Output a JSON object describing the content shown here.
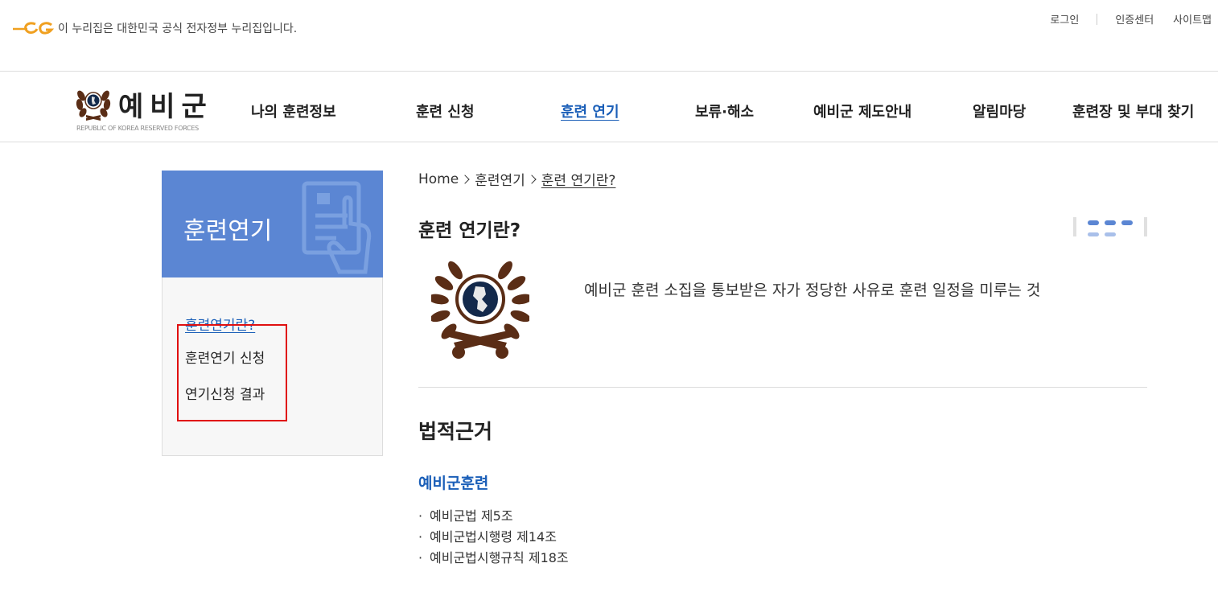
{
  "top": {
    "gov_notice": "이 누리집은 대한민국 공식 전자정부 누리집입니다.",
    "util_links": [
      "로그인",
      "인증센터",
      "사이트맵"
    ]
  },
  "brand": {
    "name": "예비군",
    "subtitle": "REPUBLIC OF KOREA RESERVED FORCES"
  },
  "nav": {
    "items": [
      "나의 훈련정보",
      "훈련 신청",
      "훈련 연기",
      "보류·해소",
      "예비군 제도안내",
      "알림마당",
      "훈련장 및 부대 찾기"
    ],
    "active_index": 2
  },
  "sidebar": {
    "title": "훈련연기",
    "items": [
      "훈련연기란?",
      "훈련연기 신청",
      "연기신청 결과"
    ],
    "active_index": 0
  },
  "breadcrumb": [
    "Home",
    "훈련연기",
    "훈련 연기란?"
  ],
  "main": {
    "title": "훈련 연기란?",
    "definition": "예비군 훈련 소집을 통보받은 자가 정당한 사유로 훈련 일정을 미루는 것",
    "section_title": "법적근거",
    "sub_title": "예비군훈련",
    "laws": [
      "예비군법 제5조",
      "예비군법시행령 제14조",
      "예비군법시행규칙 제18조"
    ]
  },
  "colors": {
    "accent": "#1b5fb8",
    "sidebar_header": "#5b86d3",
    "emblem_brown": "#5a2d16",
    "emblem_navy": "#13294b",
    "annotation": "#e01010"
  }
}
